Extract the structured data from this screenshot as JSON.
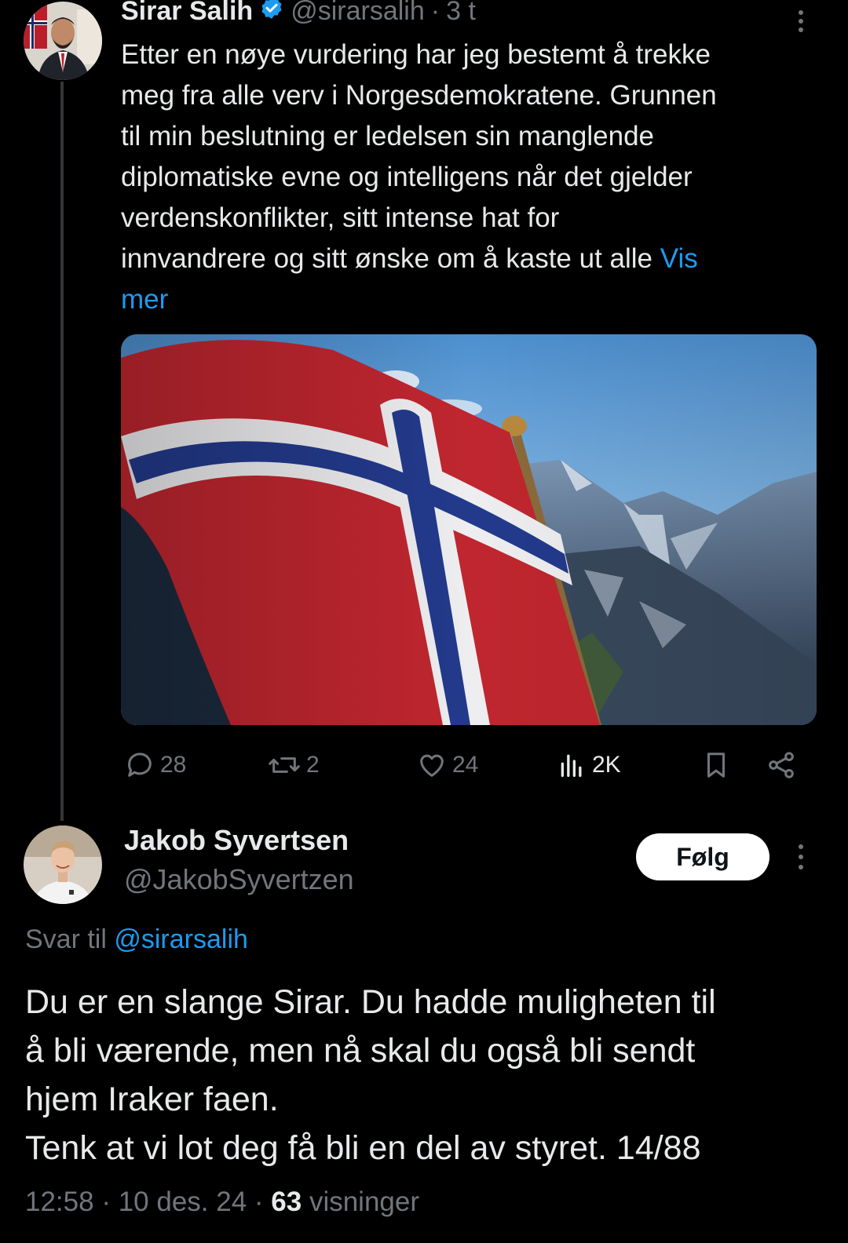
{
  "parent_tweet": {
    "name": "Sirar Salih",
    "handle": "@sirarsalih",
    "separator": "·",
    "time": "3 t",
    "text": "Etter en nøye vurdering har jeg bestemt å trekke\nmeg fra alle verv i Norgesdemokratene. Grunnen\ntil min beslutning er ledelsen sin manglende\ndiplomatiske evne og intelligens når det gjelder\nverdenskonflikter, sitt intense hat for\ninnvandrere og sitt ønske om å kaste ut alle ",
    "show_more": "Vis\nmer",
    "actions": {
      "replies": "28",
      "reposts": "2",
      "likes": "24",
      "views": "2K"
    }
  },
  "reply_tweet": {
    "name": "Jakob Syvertsen",
    "handle": "@JakobSyvertzen",
    "follow_label": "Følg",
    "reply_to_prefix": "Svar til ",
    "reply_to_handle": "@sirarsalih",
    "text": "Du er en slange Sirar. Du hadde muligheten til\nå bli værende, men nå skal du også bli sendt\nhjem Iraker faen.\nTenk at vi lot deg få bli en del av styret. 14/88",
    "time": "12:58",
    "separator1": " · ",
    "date": "10 des. 24",
    "separator2": " · ",
    "views_count": "63",
    "views_label": " visninger"
  },
  "colors": {
    "background": "#000000",
    "text_primary": "#e7e9ea",
    "text_secondary": "#71767b",
    "link": "#1d9bf0",
    "follow_button_bg": "#ffffff"
  },
  "icons": {
    "verified": "verified-badge-icon",
    "reply": "speech-bubble-icon",
    "repost": "repost-arrows-icon",
    "like": "heart-icon",
    "views": "bar-chart-icon",
    "bookmark": "bookmark-icon",
    "share": "share-icon",
    "more": "vertical-dots-icon"
  }
}
